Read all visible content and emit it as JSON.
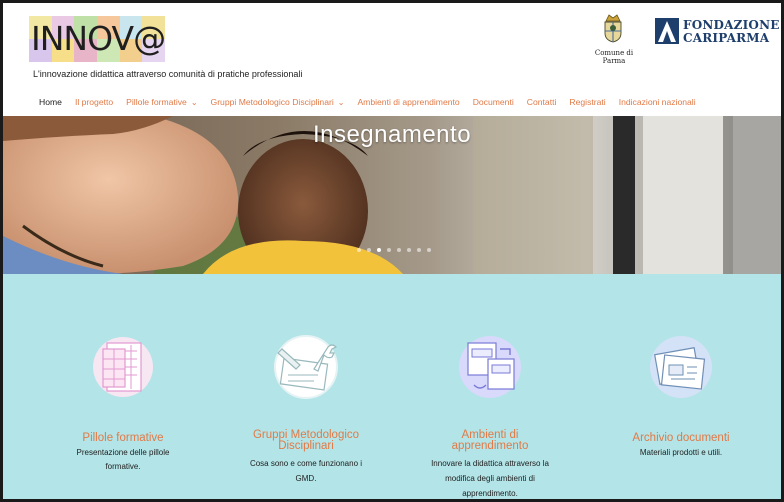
{
  "header": {
    "logo_text": "INNOV@",
    "tagline": "L'innovazione didattica attraverso comunità di pratiche professionali",
    "parma_label": "Comune di Parma",
    "fondazione_line1": "FONDAZIONE",
    "fondazione_line2": "CARIPARMA"
  },
  "nav": {
    "items": [
      {
        "label": "Home"
      },
      {
        "label": "Il progetto"
      },
      {
        "label": "Pillole formative"
      },
      {
        "label": "Gruppi Metodologico Disciplinari"
      },
      {
        "label": "Ambienti di apprendimento"
      },
      {
        "label": "Documenti"
      },
      {
        "label": "Contatti"
      },
      {
        "label": "Registrati"
      },
      {
        "label": "Indicazioni nazionali"
      }
    ]
  },
  "hero": {
    "title": "Insegnamento",
    "active_slide": 3,
    "slide_count": 8
  },
  "features": [
    {
      "title": "Pillole formative",
      "desc_lines": [
        "Presentazione delle pillole",
        "formative."
      ],
      "icon": "document-grid-icon"
    },
    {
      "title_lines": [
        "Gruppi Metodologico",
        "Disciplinari"
      ],
      "desc_lines": [
        "Cosa sono e come funzionano i",
        "GMD."
      ],
      "icon": "tools-icon"
    },
    {
      "title_lines": [
        "Ambienti di",
        "apprendimento"
      ],
      "desc_lines": [
        "Innovare la didattica attraverso la",
        "modifica degli ambienti di",
        "apprendimento."
      ],
      "icon": "layout-transform-icon"
    },
    {
      "title": "Archivio documenti",
      "desc_lines": [
        "Materiali prodotti e utili."
      ],
      "icon": "archive-icon"
    }
  ],
  "colors": {
    "accent": "#e07a47",
    "features_bg": "#b3e4e7",
    "fondazione_blue": "#1e3e6b"
  }
}
